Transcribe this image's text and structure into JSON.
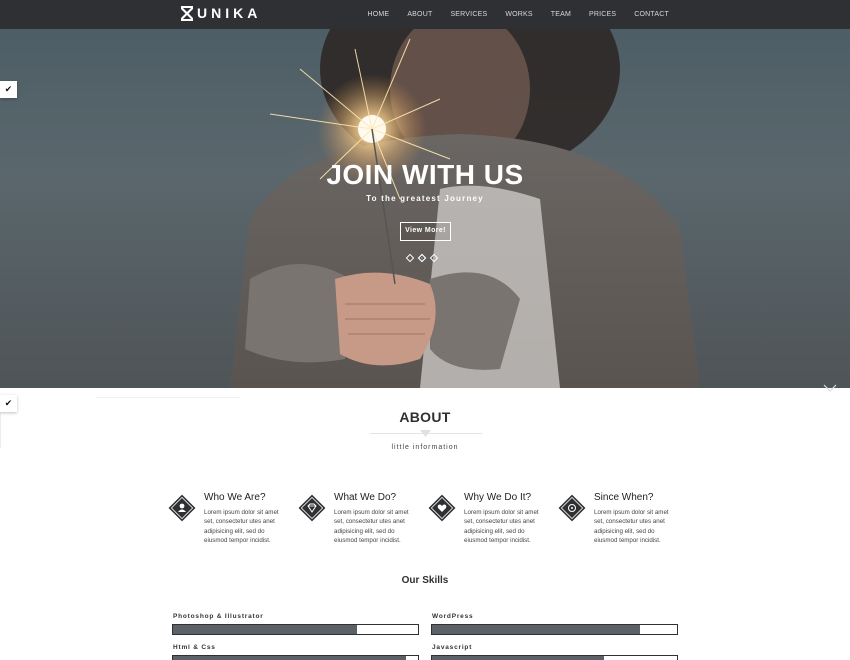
{
  "brand": {
    "name": "UNIKA"
  },
  "nav": {
    "items": [
      "HOME",
      "ABOUT",
      "SERVICES",
      "WORKS",
      "TEAM",
      "PRICES",
      "CONTACT"
    ]
  },
  "hero": {
    "title": "JOIN WITH US",
    "subtitle": "To the greatest Journey",
    "button_label": "View More!",
    "slides_count": 3,
    "active_slide": 2
  },
  "side_tabs": {
    "icon": "brush-icon"
  },
  "about": {
    "title": "ABOUT",
    "subtitle": "little information",
    "features": [
      {
        "icon": "user-icon",
        "title": "Who We Are?",
        "text": "Lorem ipsum dolor sit amet set, consectetur utes anet adipisicing elit, sed do eiusmod tempor incidist."
      },
      {
        "icon": "diamond-icon",
        "title": "What We Do?",
        "text": "Lorem ipsum dolor sit amet set, consectetur utes anet adipisicing elit, sed do eiusmod tempor incidist."
      },
      {
        "icon": "heart-icon",
        "title": "Why We Do It?",
        "text": "Lorem ipsum dolor sit amet set, consectetur utes anet adipisicing elit, sed do eiusmod tempor incidist."
      },
      {
        "icon": "clock-icon",
        "title": "Since When?",
        "text": "Lorem ipsum dolor sit amet set, consectetur utes anet adipisicing elit, sed do eiusmod tempor incidist."
      }
    ]
  },
  "skills": {
    "title": "Our Skills",
    "items": [
      {
        "label": "Photoshop & Illustrator",
        "level": 0.75
      },
      {
        "label": "WordPress",
        "level": 0.85
      },
      {
        "label": "Html & Css",
        "level": 0.95
      },
      {
        "label": "Javascript",
        "level": 0.7
      }
    ]
  },
  "colors": {
    "dark": "#2f3033",
    "bar_fill": "#5b6166",
    "white": "#ffffff"
  }
}
